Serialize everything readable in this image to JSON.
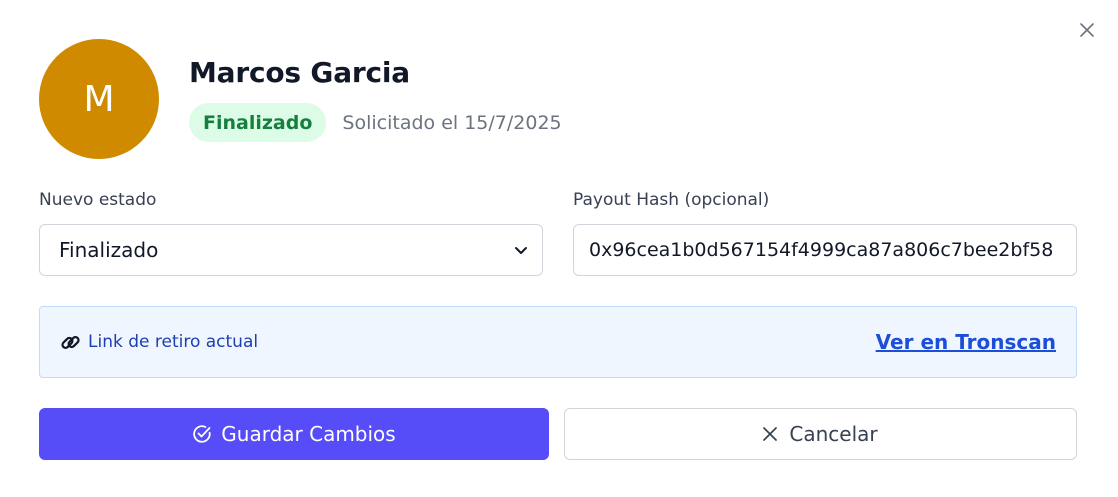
{
  "dialog": {
    "close_icon": "close-icon"
  },
  "user": {
    "initial": "M",
    "name": "Marcos Garcia",
    "status": "Finalizado",
    "requested": "Solicitado el 15/7/2025",
    "avatar_color": "#d08a00"
  },
  "form": {
    "status_label": "Nuevo estado",
    "status_value": "Finalizado",
    "hash_label": "Payout Hash (opcional)",
    "hash_value": "0x96cea1b0d567154f4999ca87a806c7bee2bf58"
  },
  "link_panel": {
    "label": "Link de retiro actual",
    "link_text": "Ver en Tronscan",
    "icon": "link-icon"
  },
  "actions": {
    "save_label": "Guardar Cambios",
    "save_icon": "check-circle-icon",
    "cancel_label": "Cancelar",
    "cancel_icon": "close-icon"
  },
  "colors": {
    "primary": "#564cf8",
    "success_bg": "#dcfce7",
    "success_text": "#15803d",
    "info_bg": "#eff6ff",
    "link": "#1d4ed8"
  }
}
